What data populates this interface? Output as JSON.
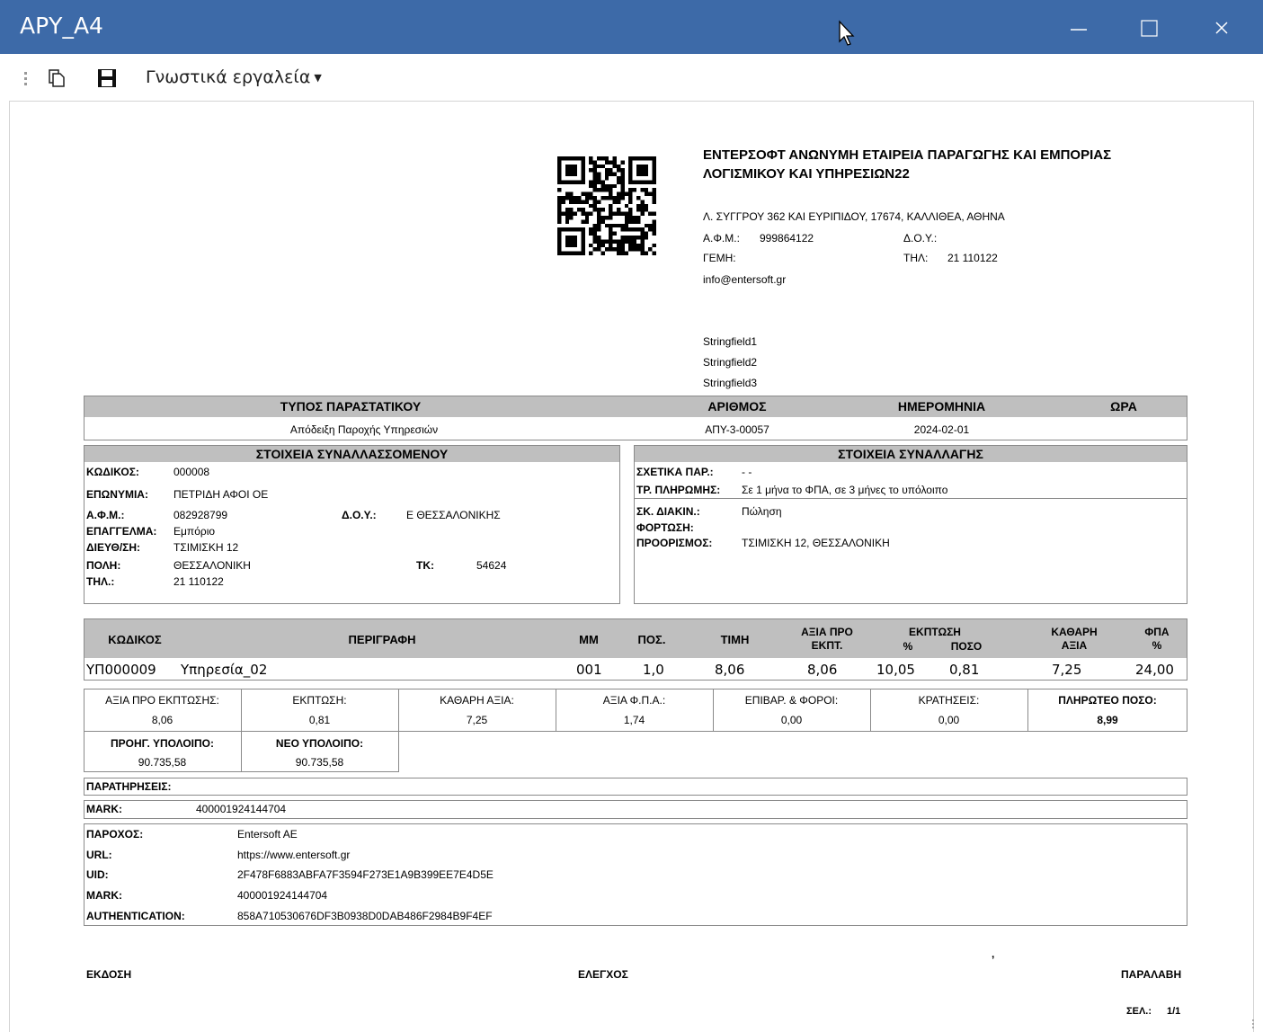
{
  "window": {
    "title": "ΑΡΥ_Α4"
  },
  "toolbar": {
    "menu_label": "Γνωστικά εργαλεία"
  },
  "company": {
    "name_line1": "ΕΝΤΕΡΣΟΦΤ ΑΝΩΝΥΜΗ ΕΤΑΙΡΕΙΑ ΠΑΡΑΓΩΓΗΣ ΚΑΙ ΕΜΠΟΡΙΑΣ",
    "name_line2": "ΛΟΓΙΣΜΙΚΟΥ ΚΑΙ ΥΠΗΡΕΣΙΩΝ22",
    "address": "Λ. ΣΥΓΓΡΟΥ 362 ΚΑΙ ΕΥΡΙΠΙΔΟΥ, 17674, ΚΑΛΛΙΘΕΑ, ΑΘΗΝΑ",
    "afm_label": "Α.Φ.Μ.:",
    "afm_value": "999864122",
    "doy_label": "Δ.Ο.Υ.:",
    "gemh_label": "ΓΕΜΗ:",
    "phone_label": "ΤΗΛ:",
    "phone_value": "21 110122",
    "email": "info@entersoft.gr",
    "stringfields": [
      "Stringfield1",
      "Stringfield2",
      "Stringfield3"
    ]
  },
  "doc_header": {
    "type_label": "ΤΥΠΟΣ ΠΑΡΑΣΤΑΤΙΚΟΥ",
    "number_label": "ΑΡΙΘΜΟΣ",
    "date_label": "ΗΜΕΡΟΜΗΝΙΑ",
    "time_label": "ΩΡΑ",
    "type_value": "Απόδειξη Παροχής Υπηρεσιών",
    "number_value": "ΑΠΥ-3-00057",
    "date_value": "2024-02-01",
    "time_value": ""
  },
  "customer": {
    "section_title": "ΣΤΟΙΧΕΙΑ ΣΥΝΑΛΛΑΣΣΟΜΕΝΟΥ",
    "code_label": "ΚΩΔΙΚΟΣ:",
    "code_value": "000008",
    "name_label": "ΕΠΩΝΥΜΙΑ:",
    "name_value": "ΠΕΤΡΙΔΗ ΑΦΟΙ ΟΕ",
    "afm_label": "Α.Φ.Μ.:",
    "afm_value": "082928799",
    "doy_label": "Δ.Ο.Υ.:",
    "doy_value": "Ε ΘΕΣΣΑΛΟΝΙΚΗΣ",
    "job_label": "ΕΠΑΓΓΕΛΜΑ:",
    "job_value": "Εμπόριο",
    "addr_label": "ΔΙΕΥΘ/ΣΗ:",
    "addr_value": "ΤΣΙΜΙΣΚΗ 12",
    "city_label": "ΠΟΛΗ:",
    "city_value": "ΘΕΣΣΑΛΟΝΙΚΗ",
    "tk_label": "ΤΚ:",
    "tk_value": "54624",
    "tel_label": "ΤΗΛ.:",
    "tel_value": "21 110122"
  },
  "transaction": {
    "section_title": "ΣΤΟΙΧΕΙΑ ΣΥΝΑΛΛΑΓΗΣ",
    "rel_label": "ΣΧΕΤΙΚΑ ΠΑΡ.:",
    "rel_value": "- -",
    "pay_label": "ΤΡ. ΠΛΗΡΩΜΗΣ:",
    "pay_value": "Σε 1 μήνα το ΦΠΑ, σε 3 μήνες το υπόλοιπο",
    "purpose_label": "ΣΚ. ΔΙΑΚΙΝ.:",
    "purpose_value": "Πώληση",
    "loading_label": "ΦΟΡΤΩΣΗ:",
    "dest_label": "ΠΡΟΟΡΙΣΜΟΣ:",
    "dest_value": "ΤΣΙΜΙΣΚΗ 12, ΘΕΣΣΑΛΟΝΙΚΗ"
  },
  "lines": {
    "headers": {
      "code": "ΚΩΔΙΚΟΣ",
      "desc": "ΠΕΡΙΓΡΑΦΗ",
      "mm": "ΜΜ",
      "qty": "ΠΟΣ.",
      "price": "ΤΙΜΗ",
      "value_before_1": "ΑΞΙΑ ΠΡΟ",
      "value_before_2": "ΕΚΠΤ.",
      "disc": "ΕΚΠΤΩΣΗ",
      "disc_pct": "%",
      "disc_amt": "ΠΟΣΟ",
      "net_1": "ΚΑΘΑΡΗ",
      "net_2": "ΑΞΙΑ",
      "vat_1": "ΦΠΑ",
      "vat_2": "%"
    },
    "rows": [
      {
        "code": "ΥΠ000009",
        "desc": "Υπηρεσία_02",
        "mm": "001",
        "qty": "1,0",
        "price": "8,06",
        "value_before": "8,06",
        "disc_pct": "10,05",
        "disc_amt": "0,81",
        "net": "7,25",
        "vat": "24,00"
      }
    ]
  },
  "totals": {
    "before_disc_label": "ΑΞΙΑ ΠΡΟ ΕΚΠΤΩΣΗΣ:",
    "before_disc_value": "8,06",
    "disc_label": "ΕΚΠΤΩΣΗ:",
    "disc_value": "0,81",
    "net_label": "ΚΑΘΑΡΗ ΑΞΙΑ:",
    "net_value": "7,25",
    "vat_label": "ΑΞΙΑ Φ.Π.Α.:",
    "vat_value": "1,74",
    "charges_label": "ΕΠΙΒΑΡ. & ΦΟΡΟΙ:",
    "charges_value": "0,00",
    "withholding_label": "ΚΡΑΤΗΣΕΙΣ:",
    "withholding_value": "0,00",
    "payable_label": "ΠΛΗΡΩΤΕΟ ΠΟΣΟ:",
    "payable_value": "8,99",
    "prev_balance_label": "ΠΡΟΗΓ. ΥΠΟΛΟΙΠΟ:",
    "prev_balance_value": "90.735,58",
    "new_balance_label": "ΝΕΟ ΥΠΟΛΟΙΠΟ:",
    "new_balance_value": "90.735,58"
  },
  "remarks": {
    "label": "ΠΑΡΑΤΗΡΗΣΕΙΣ:"
  },
  "mark": {
    "label": "MARK:",
    "value": "400001924144704"
  },
  "provider": {
    "provider_label": "ΠΑΡΟΧΟΣ:",
    "provider_value": "Entersoft AE",
    "url_label": "URL:",
    "url_value": "https://www.entersoft.gr",
    "uid_label": "UID:",
    "uid_value": "2F478F6883ABFA7F3594F273E1A9B399EE7E4D5E",
    "mark_label": "MARK:",
    "mark_value": "400001924144704",
    "auth_label": "AUTHENTICATION:",
    "auth_value": "858A710530676DF3B0938D0DAB486F2984B9F4EF"
  },
  "footer": {
    "issue": "ΕΚΔΟΣΗ",
    "check": "ΕΛΕΓΧΟΣ",
    "receipt": "ΠΑΡΑΛΑΒΗ",
    "comma": ",",
    "page_label": "ΣΕΛ.:",
    "page_value": "1/1"
  }
}
